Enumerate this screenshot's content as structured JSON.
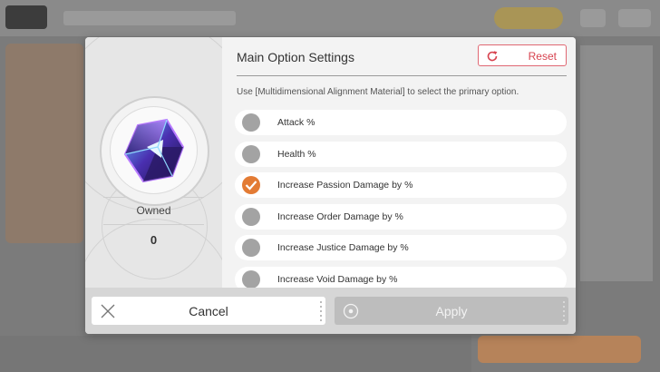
{
  "dialog": {
    "title": "Main Option Settings",
    "reset_label": "Reset",
    "description": "Use [Multidimensional Alignment Material] to select the primary option.",
    "material": {
      "icon": "crystal-cube-icon",
      "owned_label": "Owned",
      "owned_value": "0"
    },
    "options": [
      {
        "label": "Attack %",
        "selected": false
      },
      {
        "label": "Health %",
        "selected": false
      },
      {
        "label": "Increase Passion Damage by %",
        "selected": true
      },
      {
        "label": "Increase Order Damage by %",
        "selected": false
      },
      {
        "label": "Increase Justice Damage by %",
        "selected": false
      },
      {
        "label": "Increase Void Damage by %",
        "selected": false
      }
    ],
    "cancel_label": "Cancel",
    "apply_label": "Apply"
  },
  "colors": {
    "accent_orange": "#e37b34",
    "reset_red": "#d7434f",
    "apply_disabled": "#bdbdbd"
  }
}
